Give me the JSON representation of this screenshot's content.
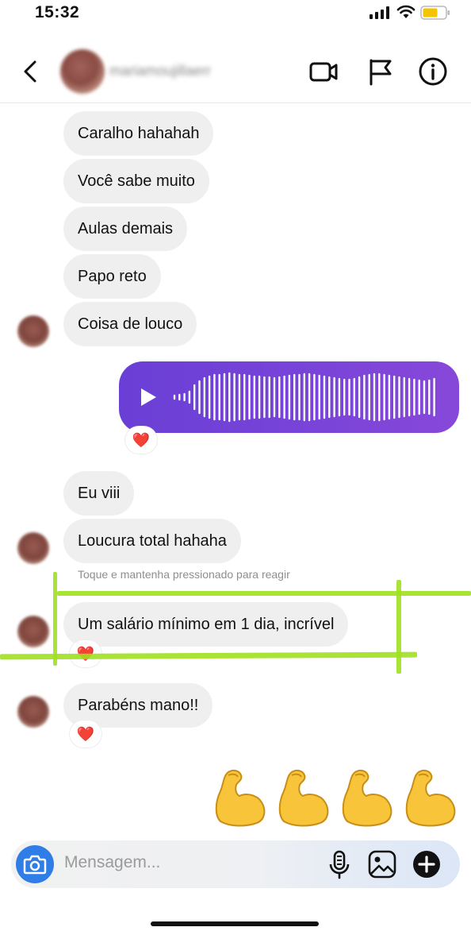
{
  "status_bar": {
    "time": "15:32",
    "icons": [
      "signal-icon",
      "wifi-icon",
      "battery-icon"
    ]
  },
  "header": {
    "contact_name": "mariamoujillaerr",
    "icons": [
      "back-chevron-icon",
      "video-call-icon",
      "flag-icon",
      "info-icon"
    ]
  },
  "messages": [
    {
      "text": "Caralho hahahah"
    },
    {
      "text": "Você sabe muito"
    },
    {
      "text": "Aulas demais"
    },
    {
      "text": "Papo reto"
    },
    {
      "text": "Coisa de louco"
    },
    {
      "type": "voice",
      "reaction": "❤️"
    },
    {
      "text": "Eu viii"
    },
    {
      "text": "Loucura total hahaha"
    },
    {
      "text": "Um salário mínimo em 1 dia, incrível",
      "reaction": "❤️"
    },
    {
      "text": "Parabéns mano!!",
      "reaction": "❤️"
    }
  ],
  "hint": "Toque e mantenha pressionado para reagir",
  "sent_emojis": [
    "flexed-biceps",
    "flexed-biceps",
    "flexed-biceps",
    "flexed-biceps"
  ],
  "composer": {
    "placeholder": "Mensagem...",
    "icons": [
      "camera-icon",
      "microphone-icon",
      "gallery-icon",
      "add-icon"
    ]
  },
  "colors": {
    "accent_voice": "#7a44d8",
    "camera_button": "#2f7ee7",
    "highlight_marker": "#9fe01f",
    "received_bubble": "#efefef",
    "heart": "#e5302d"
  }
}
